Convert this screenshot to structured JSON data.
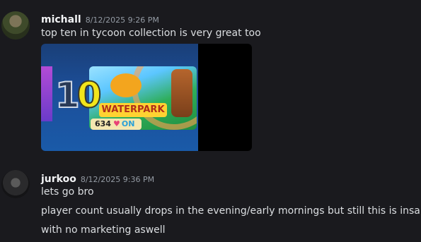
{
  "messages": [
    {
      "username": "michall",
      "timestamp": "8/12/2025 9:26 PM",
      "lines": [
        "top ten in tycoon collection is very great too"
      ],
      "embed": {
        "rank": "10",
        "game_title": "WATERPARK",
        "player_count": "634",
        "suffix": "ON",
        "heart": "♥"
      }
    },
    {
      "username": "jurkoo",
      "timestamp": "8/12/2025 9:36 PM",
      "lines": [
        "lets go bro",
        "player count usually drops in the evening/early mornings but still this is insane",
        "with no marketing aswell"
      ]
    }
  ],
  "colors": {
    "background": "#1a1a1e",
    "username": "#f2f3f5",
    "timestamp": "#949ba4",
    "text": "#dbdee1"
  }
}
